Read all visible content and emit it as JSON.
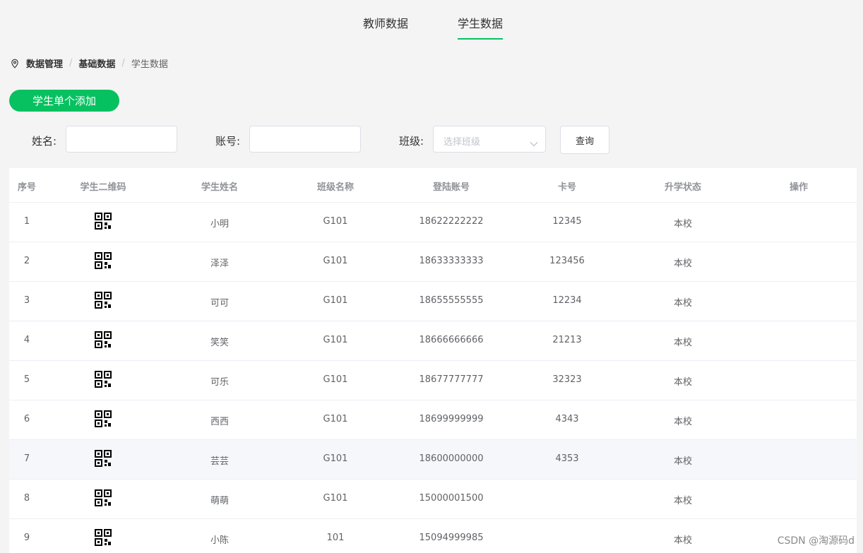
{
  "tabs": [
    {
      "label": "教师数据"
    },
    {
      "label": "学生数据"
    }
  ],
  "breadcrumb": {
    "items": [
      "数据管理",
      "基础数据"
    ],
    "separator": "/",
    "current": "学生数据"
  },
  "add_button": "学生单个添加",
  "filter": {
    "name_label": "姓名:",
    "account_label": "账号:",
    "class_label": "班级:",
    "class_placeholder": "选择班级",
    "query_button": "查询"
  },
  "table": {
    "headers": [
      "序号",
      "学生二维码",
      "学生姓名",
      "班级名称",
      "登陆账号",
      "卡号",
      "升学状态",
      "操作"
    ],
    "rows": [
      {
        "index": "1",
        "name": "小明",
        "class": "G101",
        "account": "18622222222",
        "card": "12345",
        "status": "本校"
      },
      {
        "index": "2",
        "name": "泽泽",
        "class": "G101",
        "account": "18633333333",
        "card": "123456",
        "status": "本校"
      },
      {
        "index": "3",
        "name": "可可",
        "class": "G101",
        "account": "18655555555",
        "card": "12234",
        "status": "本校"
      },
      {
        "index": "4",
        "name": "笑笑",
        "class": "G101",
        "account": "18666666666",
        "card": "21213",
        "status": "本校"
      },
      {
        "index": "5",
        "name": "可乐",
        "class": "G101",
        "account": "18677777777",
        "card": "32323",
        "status": "本校"
      },
      {
        "index": "6",
        "name": "西西",
        "class": "G101",
        "account": "18699999999",
        "card": "4343",
        "status": "本校"
      },
      {
        "index": "7",
        "name": "芸芸",
        "class": "G101",
        "account": "18600000000",
        "card": "4353",
        "status": "本校"
      },
      {
        "index": "8",
        "name": "萌萌",
        "class": "G101",
        "account": "15000001500",
        "card": "",
        "status": "本校"
      },
      {
        "index": "9",
        "name": "小陈",
        "class": "101",
        "account": "15094999985",
        "card": "",
        "status": "本校"
      }
    ]
  },
  "watermark": "CSDN @淘源码d",
  "colors": {
    "accent": "#07c160"
  }
}
